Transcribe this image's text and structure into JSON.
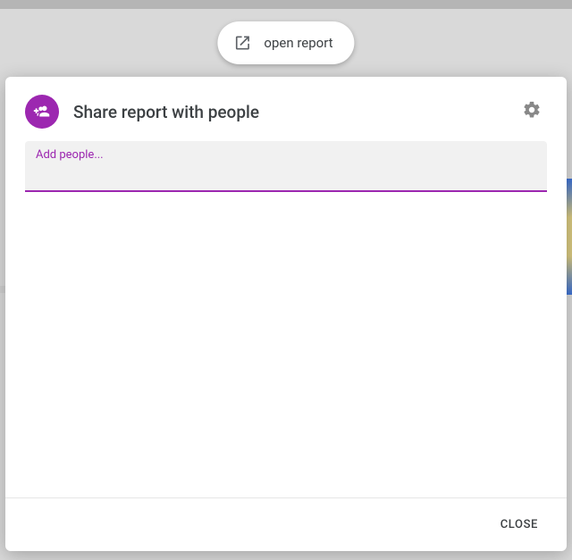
{
  "open_report_chip": {
    "label": "open report"
  },
  "dialog": {
    "title": "Share report with people",
    "input": {
      "label": "Add people...",
      "value": ""
    },
    "close_label": "Close"
  },
  "colors": {
    "accent": "#9c27b0"
  }
}
